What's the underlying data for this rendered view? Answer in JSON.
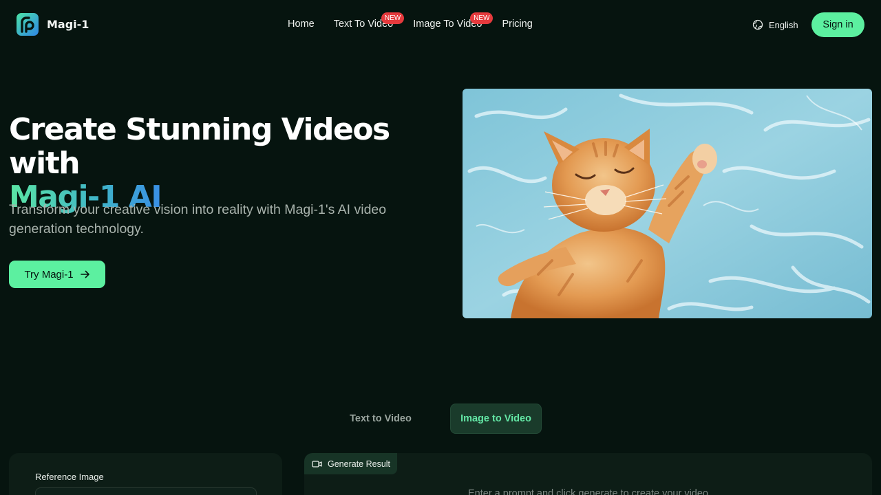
{
  "brand": {
    "name": "Magi-1"
  },
  "nav": {
    "links": [
      {
        "label": "Home"
      },
      {
        "label": "Text To Video",
        "badge": "NEW"
      },
      {
        "label": "Image To Video",
        "badge": "NEW"
      },
      {
        "label": "Pricing"
      }
    ],
    "language": "English",
    "signin_label": "Sign in"
  },
  "hero": {
    "title_line1": "Create Stunning Videos with",
    "title_line2": "Magi-1 AI",
    "subtitle": "Transform your creative vision into reality with Magi-1's AI video generation technology.",
    "cta_label": "Try Magi-1",
    "media_icon": "cat-in-water-image"
  },
  "tabs": [
    {
      "label": "Text to Video",
      "active": false
    },
    {
      "label": "Image to Video",
      "active": true
    }
  ],
  "generator": {
    "reference_label": "Reference Image",
    "result_tab_label": "Generate Result",
    "result_placeholder": "Enter a prompt and click generate to create your video"
  },
  "colors": {
    "background": "#06140f",
    "accent": "#5cf0a0",
    "badge": "#e53a3d",
    "gradient_start": "#5be6a4",
    "gradient_end": "#3a8fe6"
  }
}
